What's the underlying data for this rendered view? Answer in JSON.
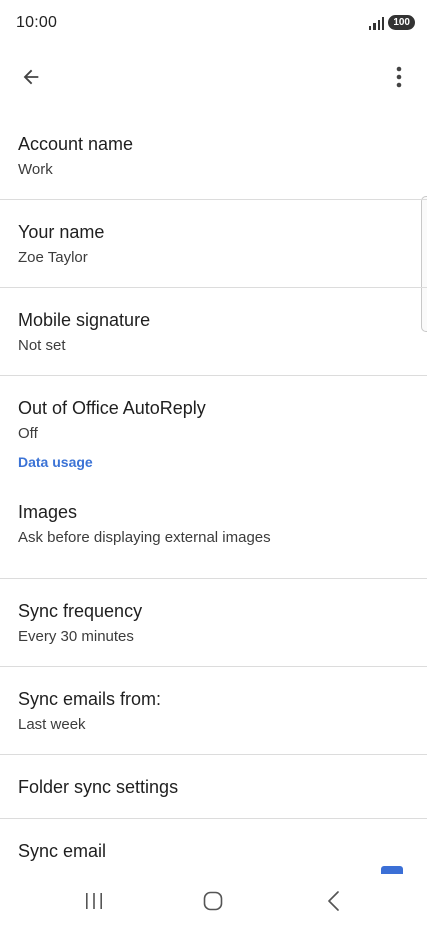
{
  "status_bar": {
    "time": "10:00",
    "battery": "100"
  },
  "app_bar": {
    "back_icon": "arrow-left-icon",
    "more_icon": "more-vertical-icon"
  },
  "settings": {
    "account_name": {
      "title": "Account name",
      "value": "Work"
    },
    "your_name": {
      "title": "Your name",
      "value": "Zoe Taylor"
    },
    "mobile_signature": {
      "title": "Mobile signature",
      "value": "Not set"
    },
    "out_of_office": {
      "title": "Out of Office AutoReply",
      "value": "Off"
    }
  },
  "data_usage": {
    "header": "Data usage",
    "images": {
      "title": "Images",
      "value": "Ask before displaying external images"
    },
    "sync_frequency": {
      "title": "Sync frequency",
      "value": "Every 30 minutes"
    },
    "sync_emails_from": {
      "title": "Sync emails from:",
      "value": "Last week"
    },
    "folder_sync": {
      "title": "Folder sync settings"
    },
    "sync_email": {
      "title": "Sync email"
    }
  },
  "nav_bar": {
    "recents_icon": "recents-icon",
    "home_icon": "home-icon",
    "back_icon": "nav-back-icon"
  },
  "colors": {
    "accent": "#3b73d6",
    "divider": "#dcdcdc",
    "text_primary": "#1f1f1f",
    "text_secondary": "#3c3c3c"
  }
}
